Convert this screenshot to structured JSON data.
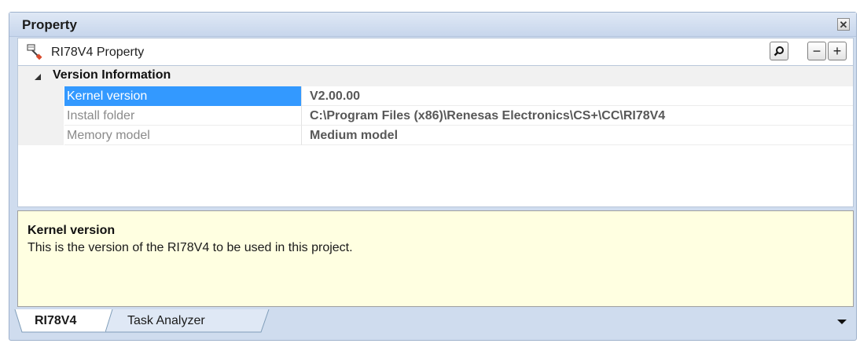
{
  "window": {
    "title": "Property",
    "close_icon": "close-x-icon"
  },
  "toolbar": {
    "icon": "property-icon",
    "title": "RI78V4 Property",
    "search_icon": "search-icon",
    "collapse_label": "−",
    "expand_label": "+"
  },
  "grid": {
    "category": {
      "label": "Version Information",
      "icon": "collapse-triangle-icon"
    },
    "rows": [
      {
        "name": "Kernel version",
        "value": "V2.00.00"
      },
      {
        "name": "Install folder",
        "value": "C:\\Program Files (x86)\\Renesas Electronics\\CS+\\CC\\RI78V4"
      },
      {
        "name": "Memory model",
        "value": "Medium model"
      }
    ]
  },
  "description": {
    "title": "Kernel version",
    "text": "This is the version of the RI78V4 to be used in this project."
  },
  "tabs": [
    {
      "label": "RI78V4",
      "active": true
    },
    {
      "label": "Task Analyzer",
      "active": false
    }
  ],
  "colors": {
    "selection": "#3399ff",
    "description_bg": "#ffffe1",
    "panel_bg": "#cfdcee"
  }
}
